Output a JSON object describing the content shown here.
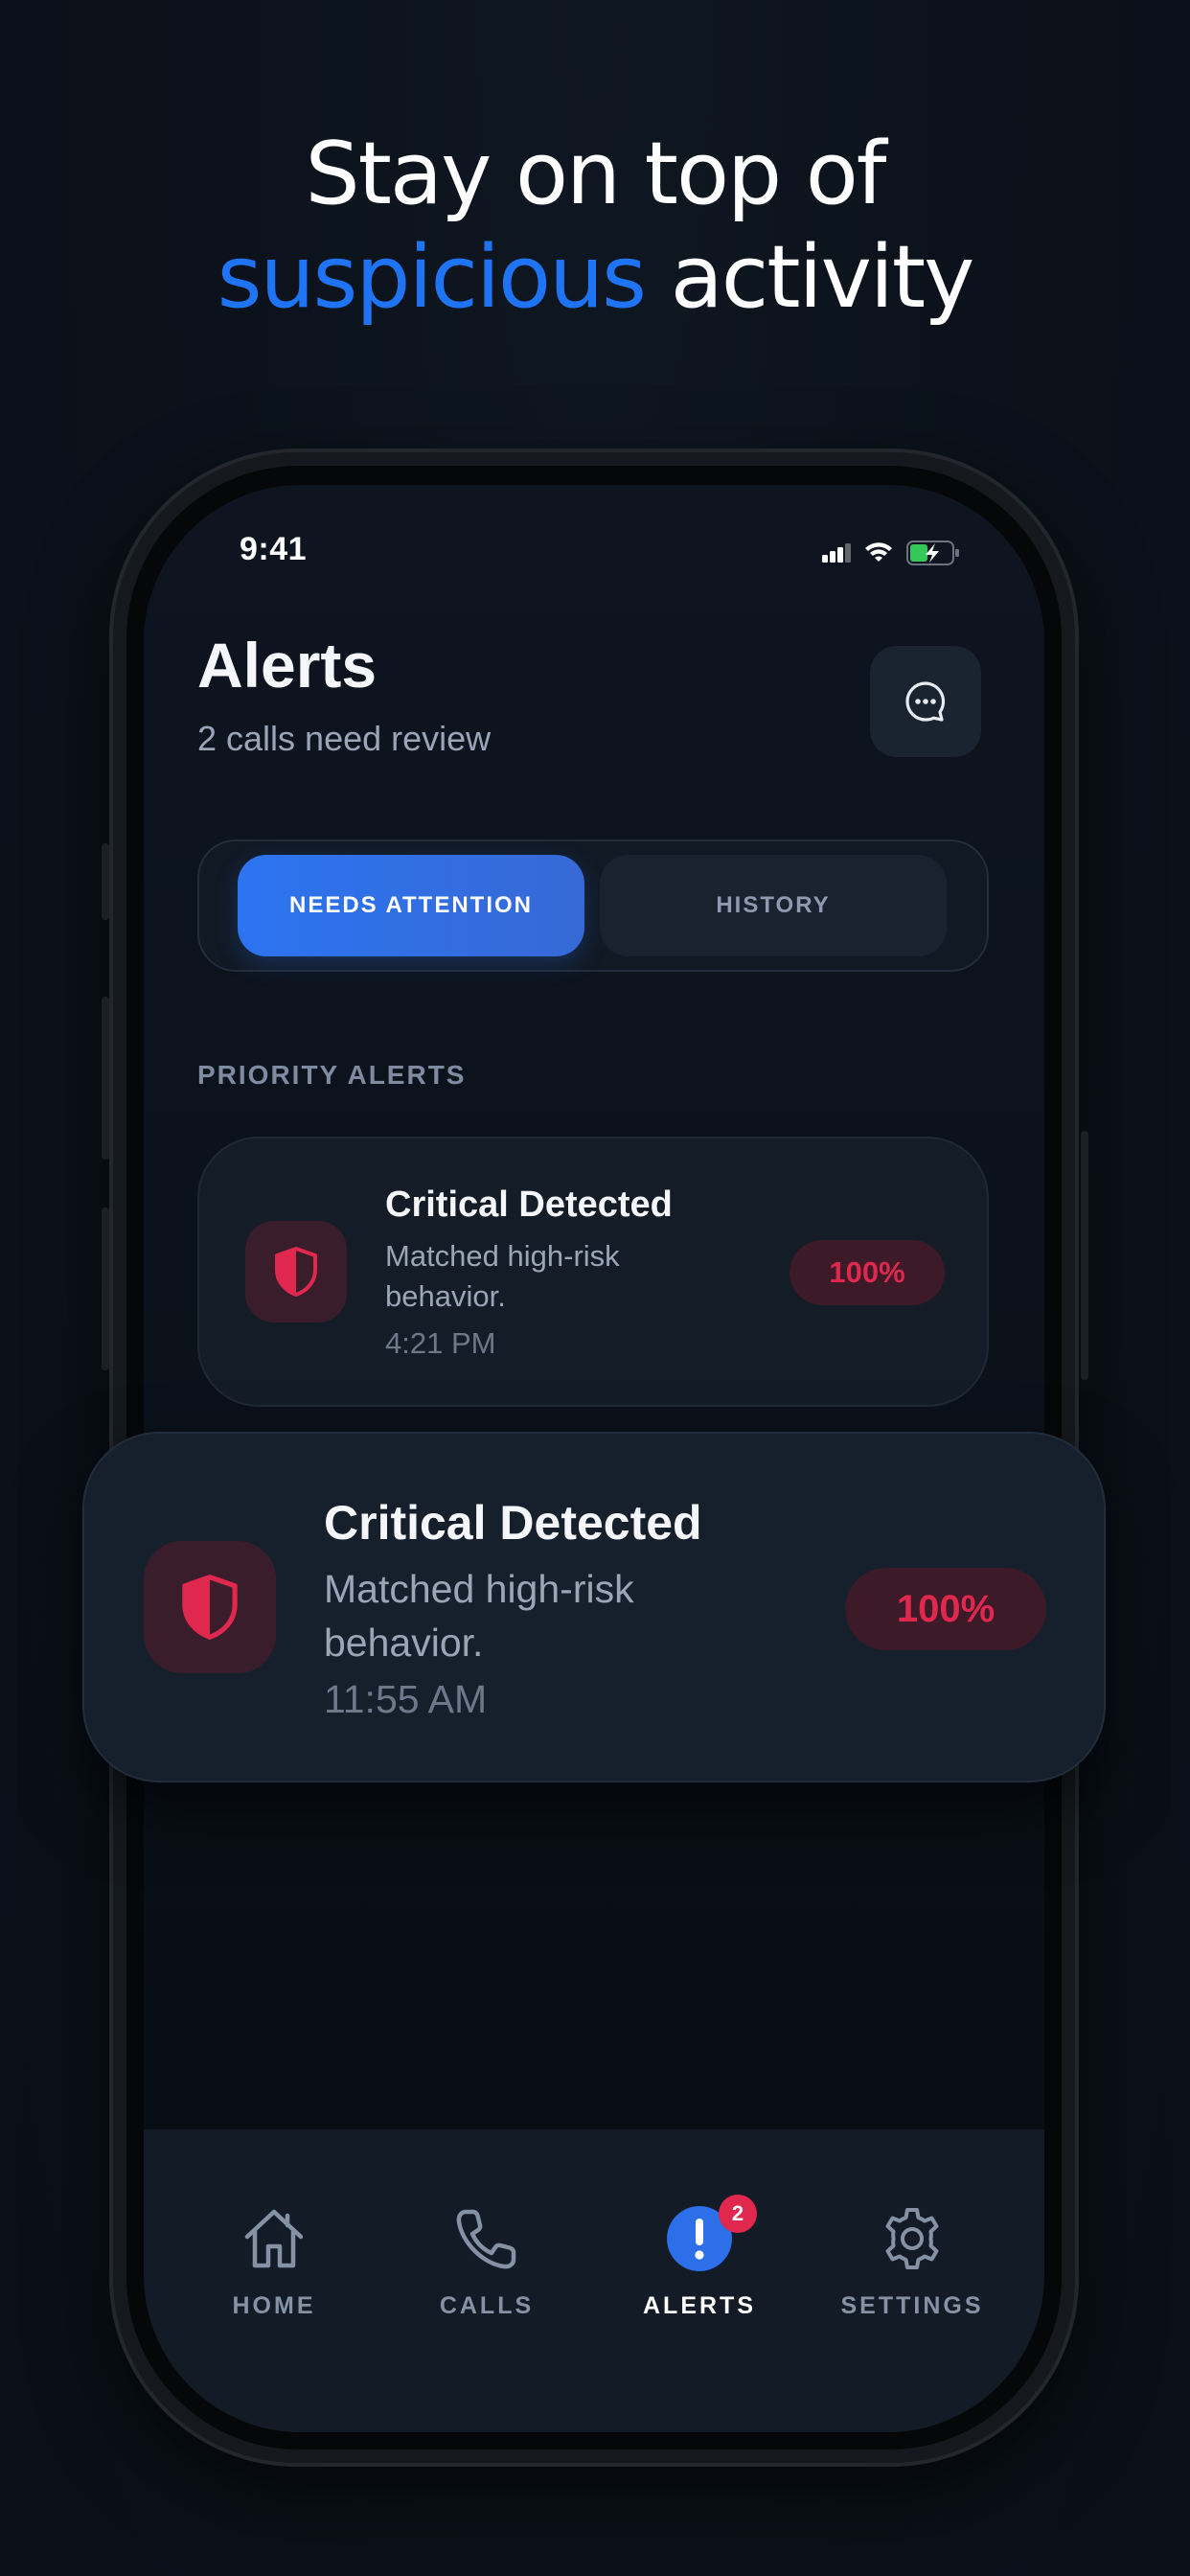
{
  "headline": {
    "line1": "Stay on top of",
    "accent": "suspicious",
    "rest": " activity"
  },
  "status_bar": {
    "time": "9:41"
  },
  "header": {
    "title": "Alerts",
    "subtitle": "2 calls need review"
  },
  "segmented": {
    "active_label": "NEEDS ATTENTION",
    "inactive_label": "HISTORY"
  },
  "section_label": "PRIORITY ALERTS",
  "alerts": [
    {
      "title": "Critical Detected",
      "desc_line1": "Matched high-risk",
      "desc_line2": "behavior.",
      "time": "4:21 PM",
      "score": "100%"
    },
    {
      "title": "Critical Detected",
      "desc_line1": "Matched high-risk",
      "desc_line2": "behavior.",
      "time": "11:55 AM",
      "score": "100%"
    }
  ],
  "tabbar": {
    "home": "HOME",
    "calls": "CALLS",
    "alerts": "ALERTS",
    "settings": "SETTINGS",
    "alerts_badge": "2"
  },
  "colors": {
    "accent_blue": "#1e74f5",
    "danger_red": "#e0284f",
    "background": "#0b121b"
  },
  "icons": [
    "message-icon",
    "shield-icon",
    "home-icon",
    "phone-icon",
    "alert-icon",
    "gear-icon",
    "signal-icon",
    "wifi-icon",
    "battery-icon"
  ]
}
